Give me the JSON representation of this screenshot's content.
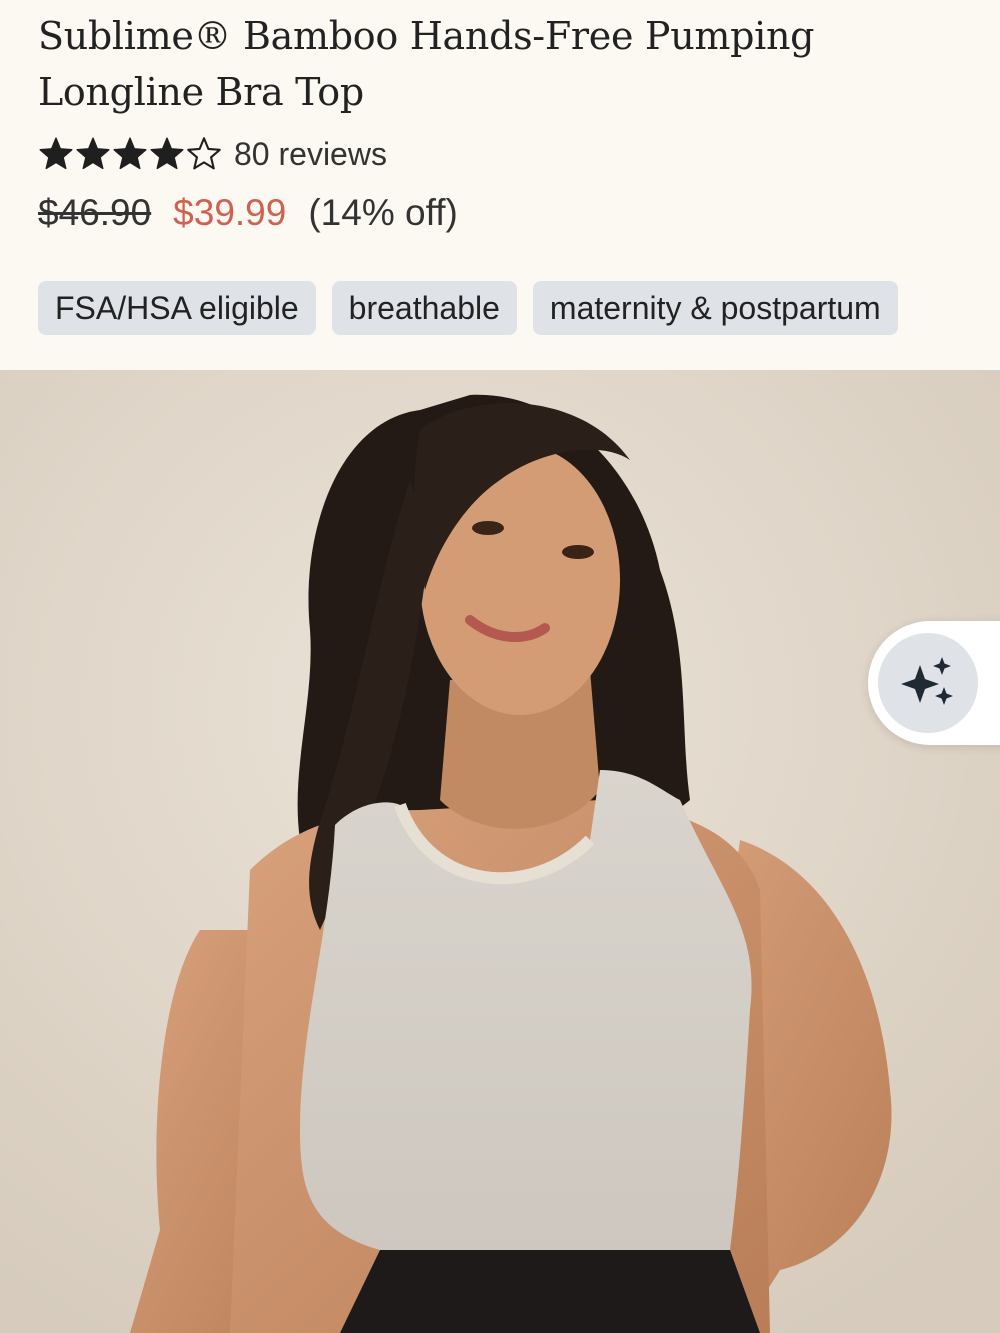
{
  "product": {
    "title": "Sublime® Bamboo Hands-Free Pumping Longline Bra Top",
    "rating": 4,
    "rating_max": 5,
    "reviews_label": "80 reviews",
    "price_original": "$46.90",
    "price_sale": "$39.99",
    "discount_label": "(14% off)"
  },
  "tags": [
    {
      "label": "FSA/HSA eligible"
    },
    {
      "label": "breathable"
    },
    {
      "label": "maternity & postpartum"
    }
  ],
  "image": {
    "alt": "Model wearing heather gray longline bra top"
  },
  "ai_button": {
    "icon": "sparkles-icon"
  },
  "colors": {
    "background": "#fcf9f2",
    "sale_price": "#d06050",
    "tag_background": "#dfe3e8",
    "text": "#222222"
  }
}
